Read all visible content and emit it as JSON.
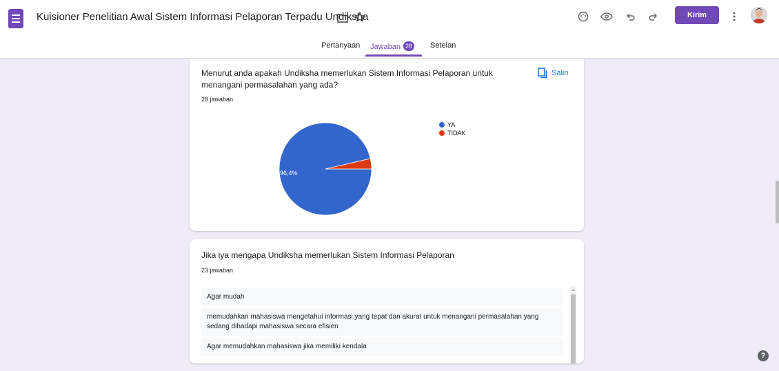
{
  "header": {
    "title": "Kuisioner Penelitian Awal Sistem Informasi Pelaporan Terpadu Undiksha",
    "send_label": "Kirim",
    "icons": [
      "forms-app-icon",
      "folder-icon",
      "star-icon",
      "palette-icon",
      "eye-icon",
      "undo-icon",
      "redo-icon",
      "more-vert-icon",
      "avatar"
    ]
  },
  "tabs": [
    {
      "label": "Pertanyaan",
      "active": false
    },
    {
      "label": "Jawaban",
      "active": true,
      "badge": "28"
    },
    {
      "label": "Setelan",
      "active": false
    }
  ],
  "accent_color": "#7248b9",
  "question1": {
    "text": "Menurut anda apakah Undiksha memerlukan Sistem Informasi Pelaporan untuk menangani permasalahan yang ada?",
    "count": "28 jawaban",
    "copy_label": "Salin"
  },
  "chart_data": {
    "type": "pie",
    "slices": [
      {
        "label": "YA",
        "value": 96.4,
        "color": "#3366cc",
        "data_label": "96,4%"
      },
      {
        "label": "TIDAK",
        "value": 3.6,
        "color": "#dc3912"
      }
    ],
    "legend_position": "right"
  },
  "question2": {
    "text": "Jika iya mengapa Undiksha memerlukan Sistem Informasi Pelaporan",
    "count": "23 jawaban",
    "answers": [
      "Agar mudah",
      "memudahkan mahasiswa mengetahui informasi yang tepat dan akurat untuk menangani permasalahan yang sedang dihadapi mahasiswa secara efisien",
      "Agar memudahkan mahasiswa jika memiliki kendala"
    ]
  },
  "help_label": "?"
}
